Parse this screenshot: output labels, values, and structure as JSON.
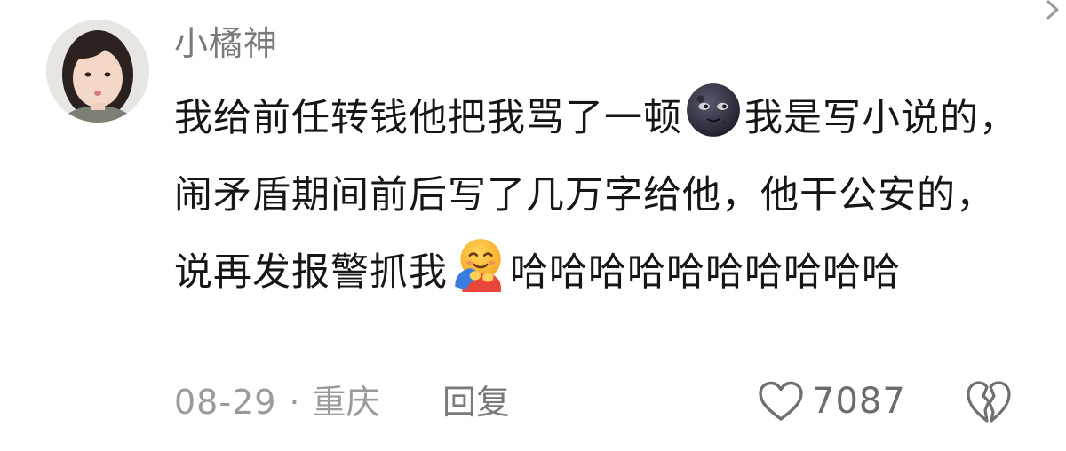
{
  "comment": {
    "username": "小橘神",
    "text_part1": "我给前任转钱他把我骂了一顿",
    "emoji1": "new-moon-face-emoji",
    "text_part2": "我是写小说的，闹矛盾期间前后写了几万字给他，他干公安的，说再发报警抓我",
    "emoji2": "hugging-face-emoji",
    "text_part3": "哈哈哈哈哈哈哈哈哈哈",
    "date": "08-29",
    "separator": "·",
    "location": "重庆",
    "reply_label": "回复",
    "like_count": "7087",
    "icons": {
      "like": "heart-outline-icon",
      "dislike": "broken-heart-outline-icon"
    },
    "colors": {
      "text": "#161616",
      "meta": "#9a9a9a",
      "username": "#7a7a7a"
    }
  }
}
